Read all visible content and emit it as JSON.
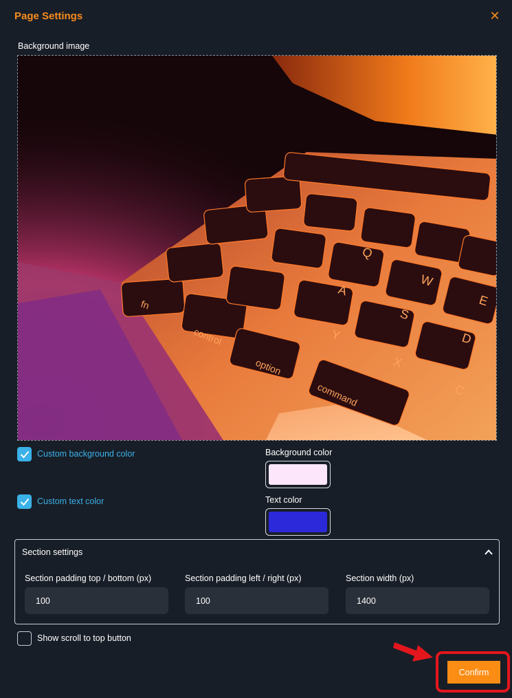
{
  "dialog": {
    "title": "Page Settings",
    "close_icon": "close-icon"
  },
  "background_image": {
    "label": "Background image"
  },
  "custom_background_color": {
    "label": "Custom background color",
    "checked": true
  },
  "background_color": {
    "label": "Background color",
    "value": "#fbe6fb"
  },
  "custom_text_color": {
    "label": "Custom text color",
    "checked": true
  },
  "text_color": {
    "label": "Text color",
    "value": "#2b29d9"
  },
  "section_settings": {
    "title": "Section settings",
    "expanded": true,
    "fields": [
      {
        "label": "Section padding top / bottom (px)",
        "value": "100"
      },
      {
        "label": "Section padding left / right (px)",
        "value": "100"
      },
      {
        "label": "Section width (px)",
        "value": "1400"
      }
    ]
  },
  "scroll_to_top": {
    "label": "Show scroll to top button",
    "checked": false
  },
  "actions": {
    "confirm_label": "Confirm"
  },
  "colors": {
    "accent": "#f68c1f",
    "checkbox": "#3ab1e8",
    "annotation": "#e4161d",
    "background": "#181e27"
  }
}
